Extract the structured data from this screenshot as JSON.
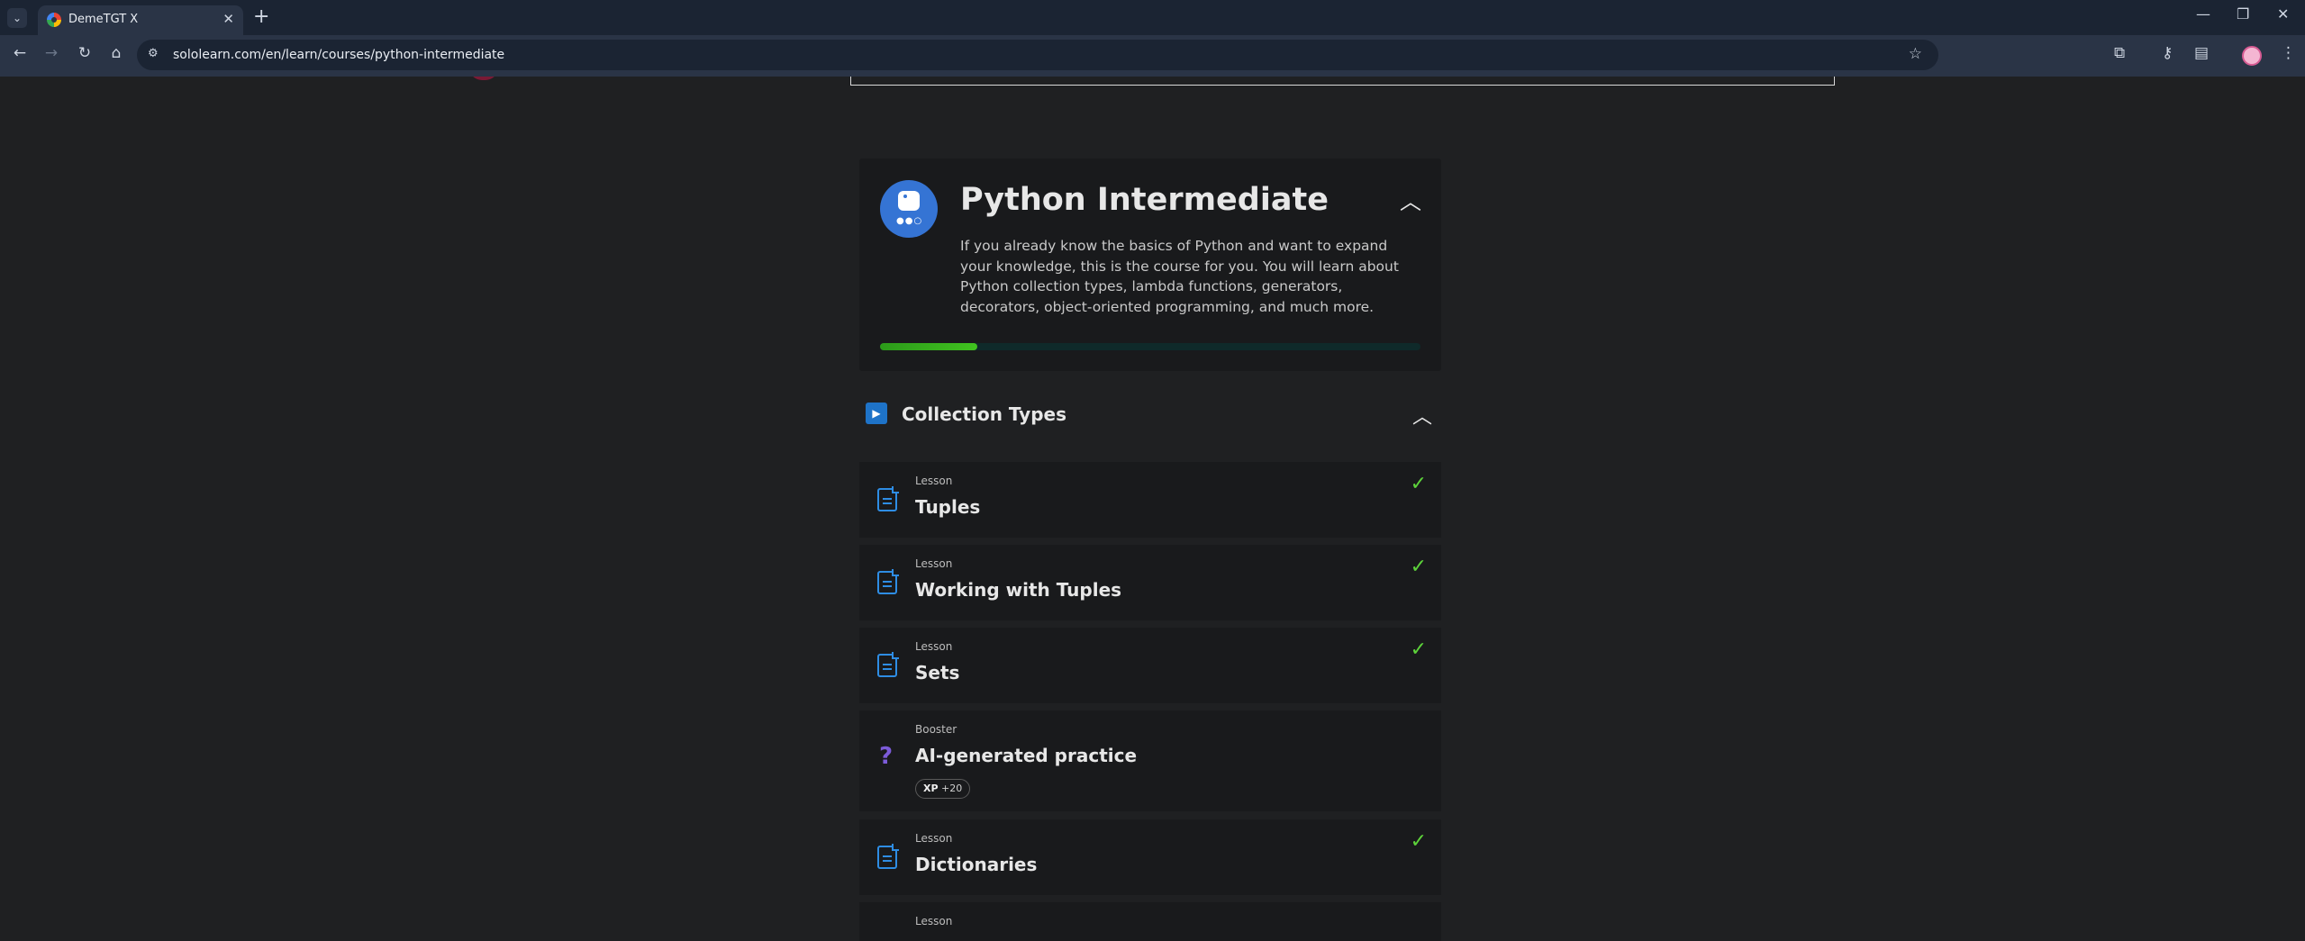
{
  "browser": {
    "tab_title": "DemeTGT X",
    "url": "sololearn.com/en/learn/courses/python-intermediate"
  },
  "course": {
    "title": "Python Intermediate",
    "description": "If you already know the basics of Python and want to expand your knowledge, this is the course for you. You will learn about Python collection types, lambda functions, generators, decorators, object-oriented programming, and much more.",
    "progress_fraction": 0.18
  },
  "section": {
    "title": "Collection Types"
  },
  "lessons": [
    {
      "kind": "Lesson",
      "name": "Tuples",
      "completed": true
    },
    {
      "kind": "Lesson",
      "name": "Working with Tuples",
      "completed": true
    },
    {
      "kind": "Lesson",
      "name": "Sets",
      "completed": true
    },
    {
      "kind": "Booster",
      "name": "AI-generated practice",
      "completed": false,
      "xp_label": "XP",
      "xp_value": "+20"
    },
    {
      "kind": "Lesson",
      "name": "Dictionaries",
      "completed": true
    },
    {
      "kind": "Lesson",
      "name": "",
      "completed": false
    }
  ],
  "colors": {
    "accent_blue": "#3574d4",
    "progress_green": "#40c31f",
    "check_green": "#5dd33a",
    "booster_purple": "#7c5bd9"
  }
}
